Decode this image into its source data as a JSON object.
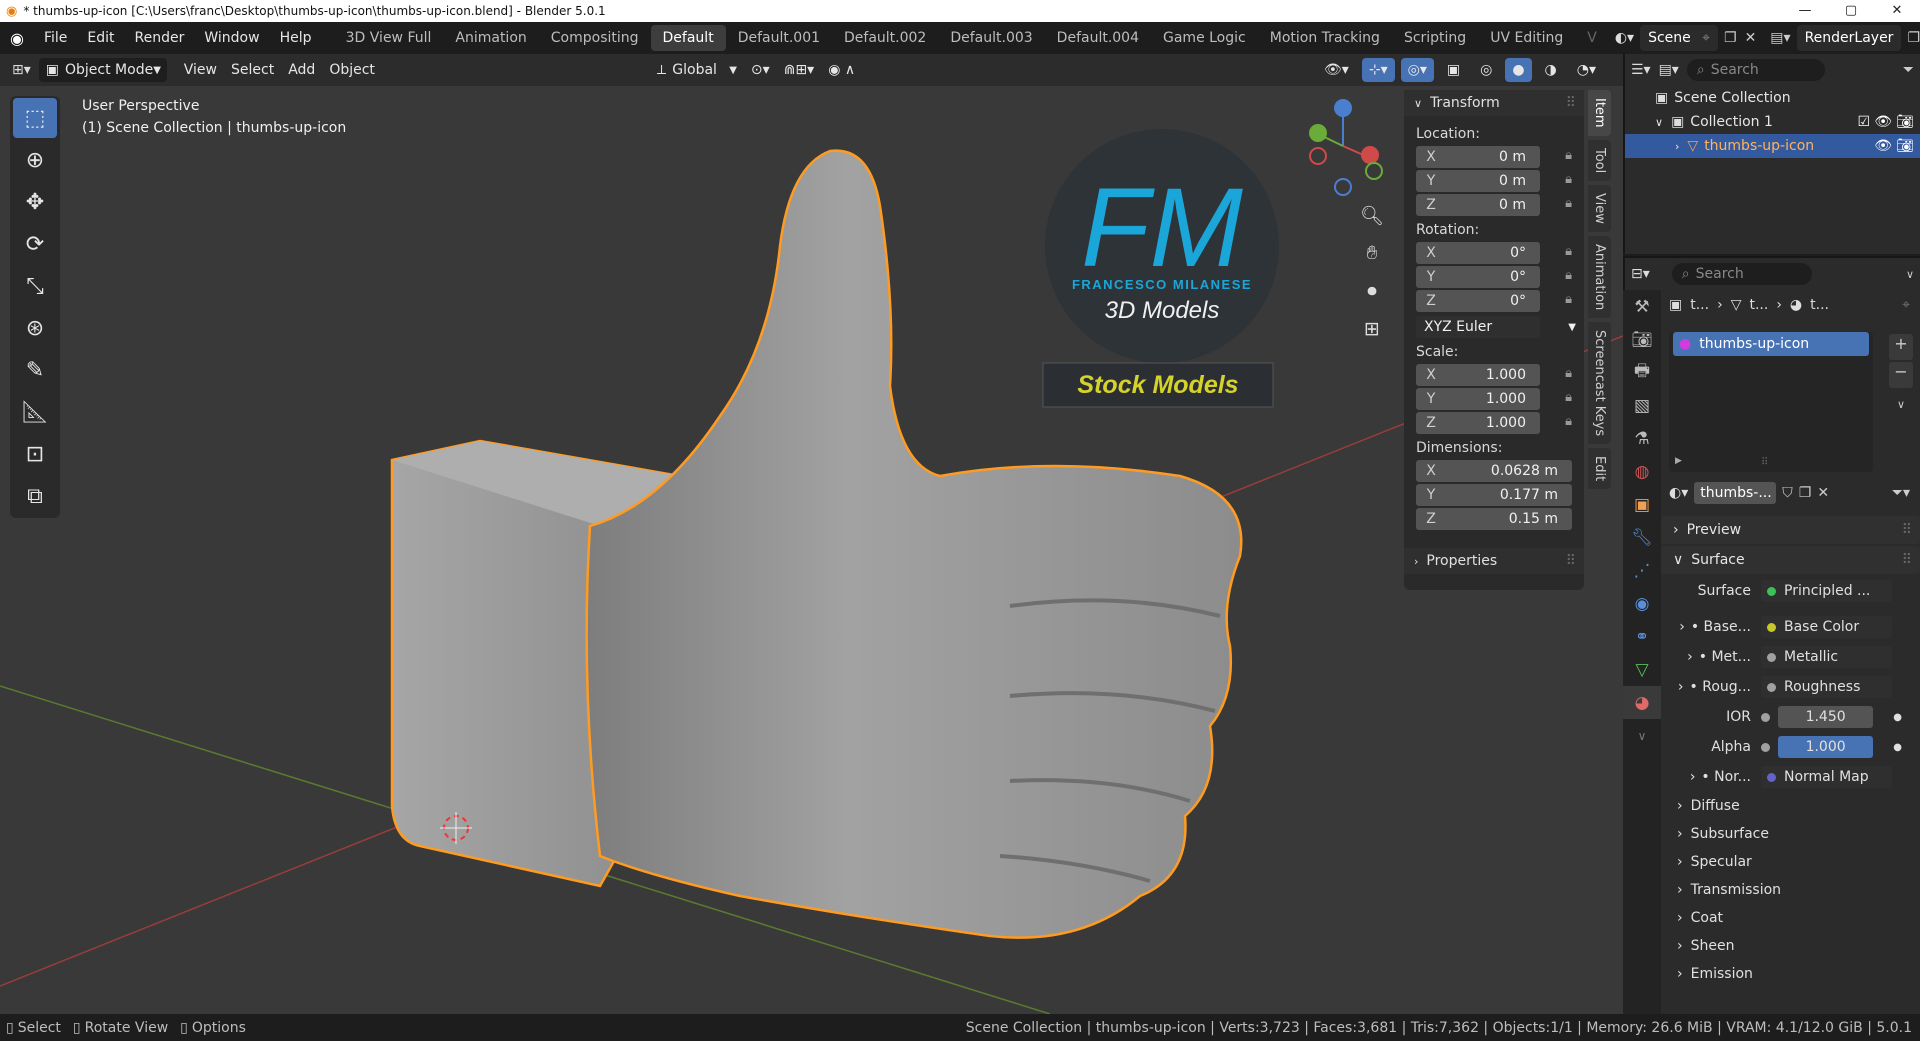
{
  "window": {
    "title": "* thumbs-up-icon [C:\\Users\\franc\\Desktop\\thumbs-up-icon\\thumbs-up-icon.blend] - Blender 5.0.1"
  },
  "menu": [
    "File",
    "Edit",
    "Render",
    "Window",
    "Help"
  ],
  "workspaces": [
    "3D View Full",
    "Animation",
    "Compositing",
    "Default",
    "Default.001",
    "Default.002",
    "Default.003",
    "Default.004",
    "Game Logic",
    "Motion Tracking",
    "Scripting",
    "UV Editing",
    "V"
  ],
  "active_workspace": "Default",
  "scene": {
    "name": "Scene",
    "render_layer": "RenderLayer"
  },
  "viewport_header": {
    "mode": "Object Mode",
    "menus": [
      "View",
      "Select",
      "Add",
      "Object"
    ],
    "orientation": "Global"
  },
  "viewport": {
    "perspective": "User Perspective",
    "context": "(1) Scene Collection | thumbs-up-icon"
  },
  "watermark": {
    "logo": "FM",
    "brand": "FRANCESCO MILANESE",
    "models": "3D Models",
    "banner": "Stock Models"
  },
  "npanel": {
    "transform_title": "Transform",
    "location_label": "Location:",
    "location": [
      {
        "axis": "X",
        "value": "0 m"
      },
      {
        "axis": "Y",
        "value": "0 m"
      },
      {
        "axis": "Z",
        "value": "0 m"
      }
    ],
    "rotation_label": "Rotation:",
    "rotation": [
      {
        "axis": "X",
        "value": "0°"
      },
      {
        "axis": "Y",
        "value": "0°"
      },
      {
        "axis": "Z",
        "value": "0°"
      }
    ],
    "rotation_mode": "XYZ Euler",
    "scale_label": "Scale:",
    "scale": [
      {
        "axis": "X",
        "value": "1.000"
      },
      {
        "axis": "Y",
        "value": "1.000"
      },
      {
        "axis": "Z",
        "value": "1.000"
      }
    ],
    "dimensions_label": "Dimensions:",
    "dimensions": [
      {
        "axis": "X",
        "value": "0.0628 m"
      },
      {
        "axis": "Y",
        "value": "0.177 m"
      },
      {
        "axis": "Z",
        "value": "0.15 m"
      }
    ],
    "properties_title": "Properties",
    "tabs": [
      "Item",
      "Tool",
      "View",
      "Animation",
      "Screencast Keys",
      "Edit"
    ]
  },
  "outliner": {
    "search_placeholder": "Search",
    "items": [
      {
        "label": "Scene Collection"
      },
      {
        "label": "Collection 1"
      },
      {
        "label": "thumbs-up-icon"
      }
    ]
  },
  "properties": {
    "search_placeholder": "Search",
    "breadcrumb": [
      "t...",
      "t...",
      "t..."
    ],
    "material_slot": "thumbs-up-icon",
    "material_name": "thumbs-...",
    "preview_label": "Preview",
    "surface_label": "Surface",
    "rows": [
      {
        "label": "Surface",
        "value": "Principled ...",
        "socket": "#3fbf5a"
      },
      {
        "label": "Base...",
        "value": "Base Color",
        "socket": "#c7c729"
      },
      {
        "label": "Met...",
        "value": "Metallic",
        "socket": "#a1a1a1"
      },
      {
        "label": "Roug...",
        "value": "Roughness",
        "socket": "#a1a1a1"
      },
      {
        "label": "IOR",
        "value": "1.450",
        "socket": "#a1a1a1"
      },
      {
        "label": "Alpha",
        "value": "1.000",
        "socket": "#a1a1a1"
      },
      {
        "label": "Nor...",
        "value": "Normal Map",
        "socket": "#6363c7"
      }
    ],
    "subpanels": [
      "Diffuse",
      "Subsurface",
      "Specular",
      "Transmission",
      "Coat",
      "Sheen",
      "Emission"
    ]
  },
  "status": {
    "hints": [
      "Select",
      "Rotate View",
      "Options"
    ],
    "stats": "Scene Collection | thumbs-up-icon | Verts:3,723 | Faces:3,681 | Tris:7,362 | Objects:1/1 | Memory: 26.6 MiB | VRAM: 4.1/12.0 GiB | 5.0.1"
  },
  "colors": {
    "accent": "#4772b3",
    "selection_outline": "#ff9b21",
    "viewport_bg": "#393939"
  }
}
